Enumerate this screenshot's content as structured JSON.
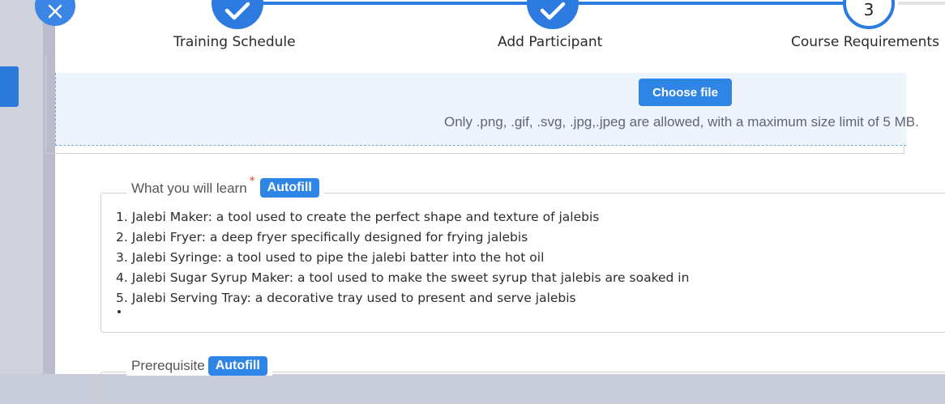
{
  "stepper": {
    "steps": [
      {
        "label": "Training Schedule",
        "state": "complete"
      },
      {
        "label": "Add Participant",
        "state": "complete"
      },
      {
        "label": "Course Requirements",
        "state": "current",
        "number": "3"
      }
    ]
  },
  "upload": {
    "button_label": "Choose file",
    "hint": "Only .png, .gif, .svg, .jpg,.jpeg are allowed, with a maximum size limit of 5 MB."
  },
  "learn": {
    "legend": "What you will learn",
    "required_mark": "*",
    "autofill_label": "Autofill",
    "items": [
      "1. Jalebi Maker: a tool used to create the perfect shape and texture of jalebis",
      "2. Jalebi Fryer: a deep fryer specifically designed for frying jalebis",
      "3. Jalebi Syringe: a tool used to pipe the jalebi batter into the hot oil",
      "4. Jalebi Sugar Syrup Maker: a tool used to make the sweet syrup that jalebis are soaked in",
      "5. Jalebi Serving Tray: a decorative tray used to present and serve jalebis"
    ]
  },
  "prerequisite": {
    "legend": "Prerequisite",
    "autofill_label": "Autofill"
  },
  "colors": {
    "accent": "#2f85e6",
    "step_line": "#2d7be0",
    "required": "#e0403a",
    "upload_bg": "#eef4fc"
  },
  "icons": {
    "close": "close-icon",
    "step_complete": "checkmark-icon"
  }
}
